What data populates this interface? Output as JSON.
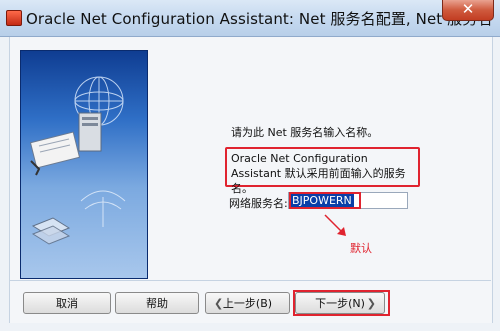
{
  "window": {
    "title": "Oracle Net Configuration Assistant: Net 服务名配置, Net 服务名",
    "close_glyph": "✕"
  },
  "main": {
    "prompt": "请为此 Net 服务名输入名称。",
    "info_text": "Oracle Net Configuration Assistant 默认采用前面输入的服务名。",
    "service_name_label": "网络服务名:",
    "service_name_value": "BJPOWERN",
    "annotation": "默认"
  },
  "buttons": {
    "cancel": "取消",
    "help": "帮助",
    "back": "上一步(B)",
    "next": "下一步(N)",
    "chevron_left": "❮",
    "chevron_right": "❯"
  },
  "colors": {
    "annotation_red": "#e0232f",
    "selection_blue": "#0a3fa8"
  }
}
